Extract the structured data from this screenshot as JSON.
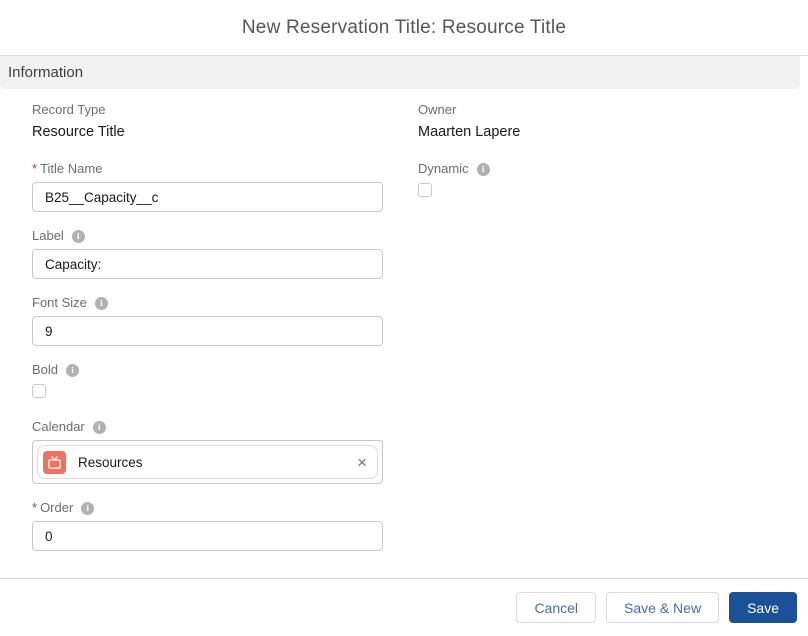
{
  "modal": {
    "title": "New Reservation Title: Resource Title"
  },
  "section": {
    "title": "Information"
  },
  "required_marker": "*",
  "icons": {
    "info": "i",
    "remove": "×"
  },
  "fields": {
    "record_type": {
      "label": "Record Type",
      "value": "Resource Title"
    },
    "owner": {
      "label": "Owner",
      "value": "Maarten Lapere"
    },
    "title_name": {
      "label": "Title Name",
      "required": true,
      "value": "B25__Capacity__c"
    },
    "dynamic": {
      "label": "Dynamic",
      "checked": false
    },
    "label_field": {
      "label": "Label",
      "value": "Capacity:"
    },
    "font_size": {
      "label": "Font Size",
      "value": "9"
    },
    "bold": {
      "label": "Bold",
      "checked": false
    },
    "calendar": {
      "label": "Calendar",
      "pill": {
        "text": "Resources",
        "icon": "tv-icon"
      }
    },
    "order": {
      "label": "Order",
      "required": true,
      "value": "0"
    }
  },
  "footer": {
    "cancel_label": "Cancel",
    "save_new_label": "Save & New",
    "save_label": "Save"
  },
  "colors": {
    "brand_button": "#1b5297",
    "button_text_blue": "#466bb0",
    "required_red": "#c23934",
    "section_band": "#f3f2f2",
    "pill_icon": "#f07362"
  }
}
